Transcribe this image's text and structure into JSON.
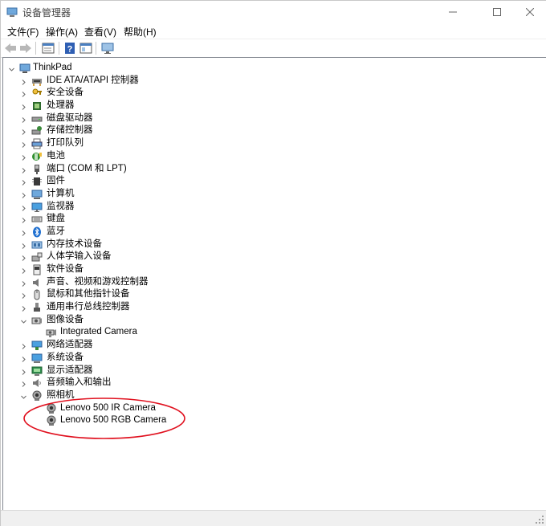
{
  "window": {
    "title": "设备管理器"
  },
  "menu": [
    "文件(F)",
    "操作(A)",
    "查看(V)",
    "帮助(H)"
  ],
  "toolbar_icons": [
    "back-arrow-icon",
    "forward-arrow-icon",
    "properties-icon",
    "help-icon",
    "view-icon",
    "monitor-scan-icon"
  ],
  "tree": {
    "root": "ThinkPad",
    "nodes": [
      {
        "label": "IDE ATA/ATAPI 控制器",
        "icon": "ide-controller-icon",
        "expanded": false
      },
      {
        "label": "安全设备",
        "icon": "security-device-icon",
        "expanded": false
      },
      {
        "label": "处理器",
        "icon": "processor-icon",
        "expanded": false
      },
      {
        "label": "磁盘驱动器",
        "icon": "disk-drive-icon",
        "expanded": false
      },
      {
        "label": "存储控制器",
        "icon": "storage-controller-icon",
        "expanded": false
      },
      {
        "label": "打印队列",
        "icon": "printer-icon",
        "expanded": false
      },
      {
        "label": "电池",
        "icon": "battery-icon",
        "expanded": false
      },
      {
        "label": "端口 (COM 和 LPT)",
        "icon": "port-icon",
        "expanded": false
      },
      {
        "label": "固件",
        "icon": "firmware-icon",
        "expanded": false
      },
      {
        "label": "计算机",
        "icon": "computer-icon",
        "expanded": false
      },
      {
        "label": "监视器",
        "icon": "monitor-icon",
        "expanded": false
      },
      {
        "label": "键盘",
        "icon": "keyboard-icon",
        "expanded": false
      },
      {
        "label": "蓝牙",
        "icon": "bluetooth-icon",
        "expanded": false
      },
      {
        "label": "内存技术设备",
        "icon": "memory-device-icon",
        "expanded": false
      },
      {
        "label": "人体学输入设备",
        "icon": "hid-icon",
        "expanded": false
      },
      {
        "label": "软件设备",
        "icon": "software-device-icon",
        "expanded": false
      },
      {
        "label": "声音、视频和游戏控制器",
        "icon": "speaker-icon",
        "expanded": false
      },
      {
        "label": "鼠标和其他指针设备",
        "icon": "mouse-icon",
        "expanded": false
      },
      {
        "label": "通用串行总线控制器",
        "icon": "usb-icon",
        "expanded": false
      },
      {
        "label": "图像设备",
        "icon": "imaging-device-icon",
        "expanded": true,
        "children": [
          {
            "label": "Integrated Camera",
            "icon": "camera-icon"
          }
        ]
      },
      {
        "label": "网络适配器",
        "icon": "network-adapter-icon",
        "expanded": false
      },
      {
        "label": "系统设备",
        "icon": "system-device-icon",
        "expanded": false
      },
      {
        "label": "显示适配器",
        "icon": "display-adapter-icon",
        "expanded": false
      },
      {
        "label": "音频输入和输出",
        "icon": "audio-io-icon",
        "expanded": false
      },
      {
        "label": "照相机",
        "icon": "webcam-icon",
        "expanded": true,
        "children": [
          {
            "label": "Lenovo 500 IR Camera",
            "icon": "webcam-icon"
          },
          {
            "label": "Lenovo 500 RGB Camera",
            "icon": "webcam-icon"
          }
        ]
      }
    ]
  },
  "colors": {
    "annotation": "#e0101e",
    "window_border": "#c8c8c8",
    "tree_border": "#828790"
  }
}
